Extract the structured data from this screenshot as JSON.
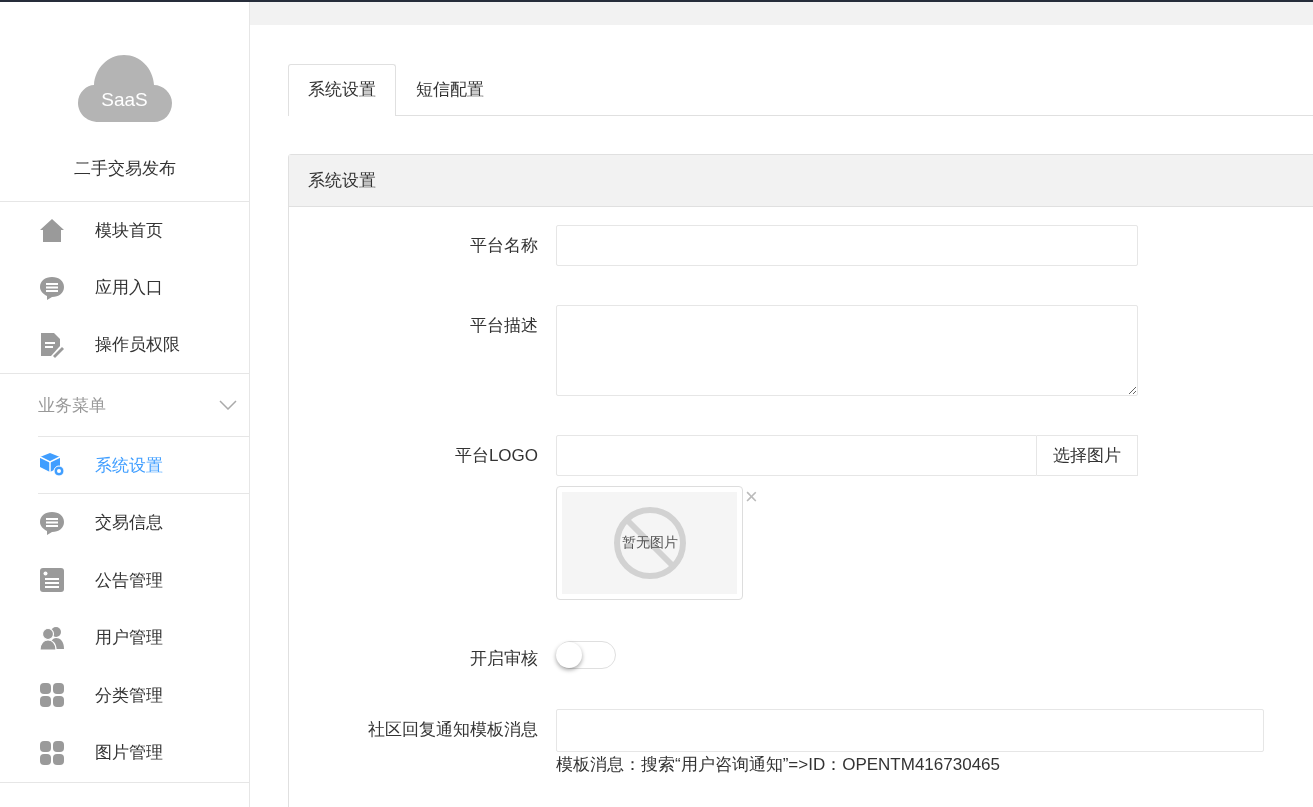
{
  "sidebar": {
    "logo_text": "SaaS",
    "app_name": "二手交易发布",
    "top_items": [
      {
        "label": "模块首页"
      },
      {
        "label": "应用入口"
      },
      {
        "label": "操作员权限"
      }
    ],
    "section": {
      "label": "业务菜单",
      "expanded": true,
      "items": [
        {
          "label": "系统设置",
          "selected": true
        },
        {
          "label": "交易信息",
          "selected": false
        },
        {
          "label": "公告管理",
          "selected": false
        },
        {
          "label": "用户管理",
          "selected": false
        },
        {
          "label": "分类管理",
          "selected": false
        },
        {
          "label": "图片管理",
          "selected": false
        }
      ]
    }
  },
  "tabs": [
    {
      "label": "系统设置",
      "selected": true
    },
    {
      "label": "短信配置",
      "selected": false
    }
  ],
  "panel": {
    "title": "系统设置",
    "fields": [
      {
        "kind": "text",
        "label": "平台名称"
      },
      {
        "kind": "textarea",
        "label": "平台描述"
      },
      {
        "kind": "image",
        "label": "平台LOGO",
        "button": "选择图片",
        "remove": "×",
        "empty_text": "暂无图片"
      },
      {
        "kind": "switch",
        "label": "开启审核",
        "on": false
      },
      {
        "kind": "wide",
        "label": "社区回复通知模板消息",
        "hint": "模板消息：搜索“用户咨询通知”=>ID：OPENTM416730465"
      }
    ]
  }
}
